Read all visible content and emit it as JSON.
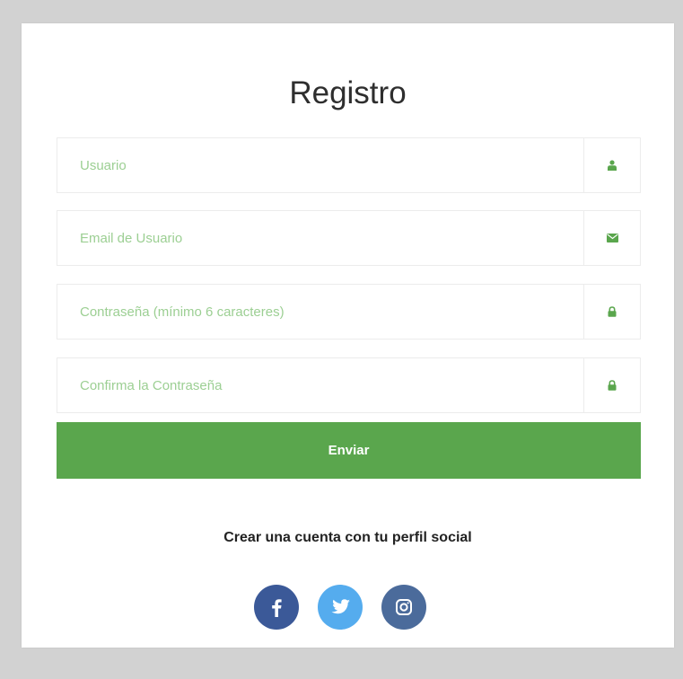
{
  "form": {
    "title": "Registro",
    "fields": [
      {
        "placeholder": "Usuario",
        "value": "",
        "icon": "user-icon"
      },
      {
        "placeholder": "Email de Usuario",
        "value": "",
        "icon": "envelope-icon"
      },
      {
        "placeholder": "Contraseña (mínimo 6 caracteres)",
        "value": "",
        "icon": "lock-icon"
      },
      {
        "placeholder": "Confirma la Contraseña",
        "value": "",
        "icon": "lock-icon"
      }
    ],
    "submit_label": "Enviar"
  },
  "social": {
    "heading": "Crear una cuenta con tu perfil social",
    "buttons": [
      {
        "icon": "facebook-icon",
        "color": "#3b5998"
      },
      {
        "icon": "twitter-icon",
        "color": "#55acee"
      },
      {
        "icon": "instagram-icon",
        "color": "#4b6b9b"
      }
    ]
  },
  "colors": {
    "accent": "#5aa64d",
    "placeholder": "#9ccf93",
    "background": "#d2d2d2"
  }
}
